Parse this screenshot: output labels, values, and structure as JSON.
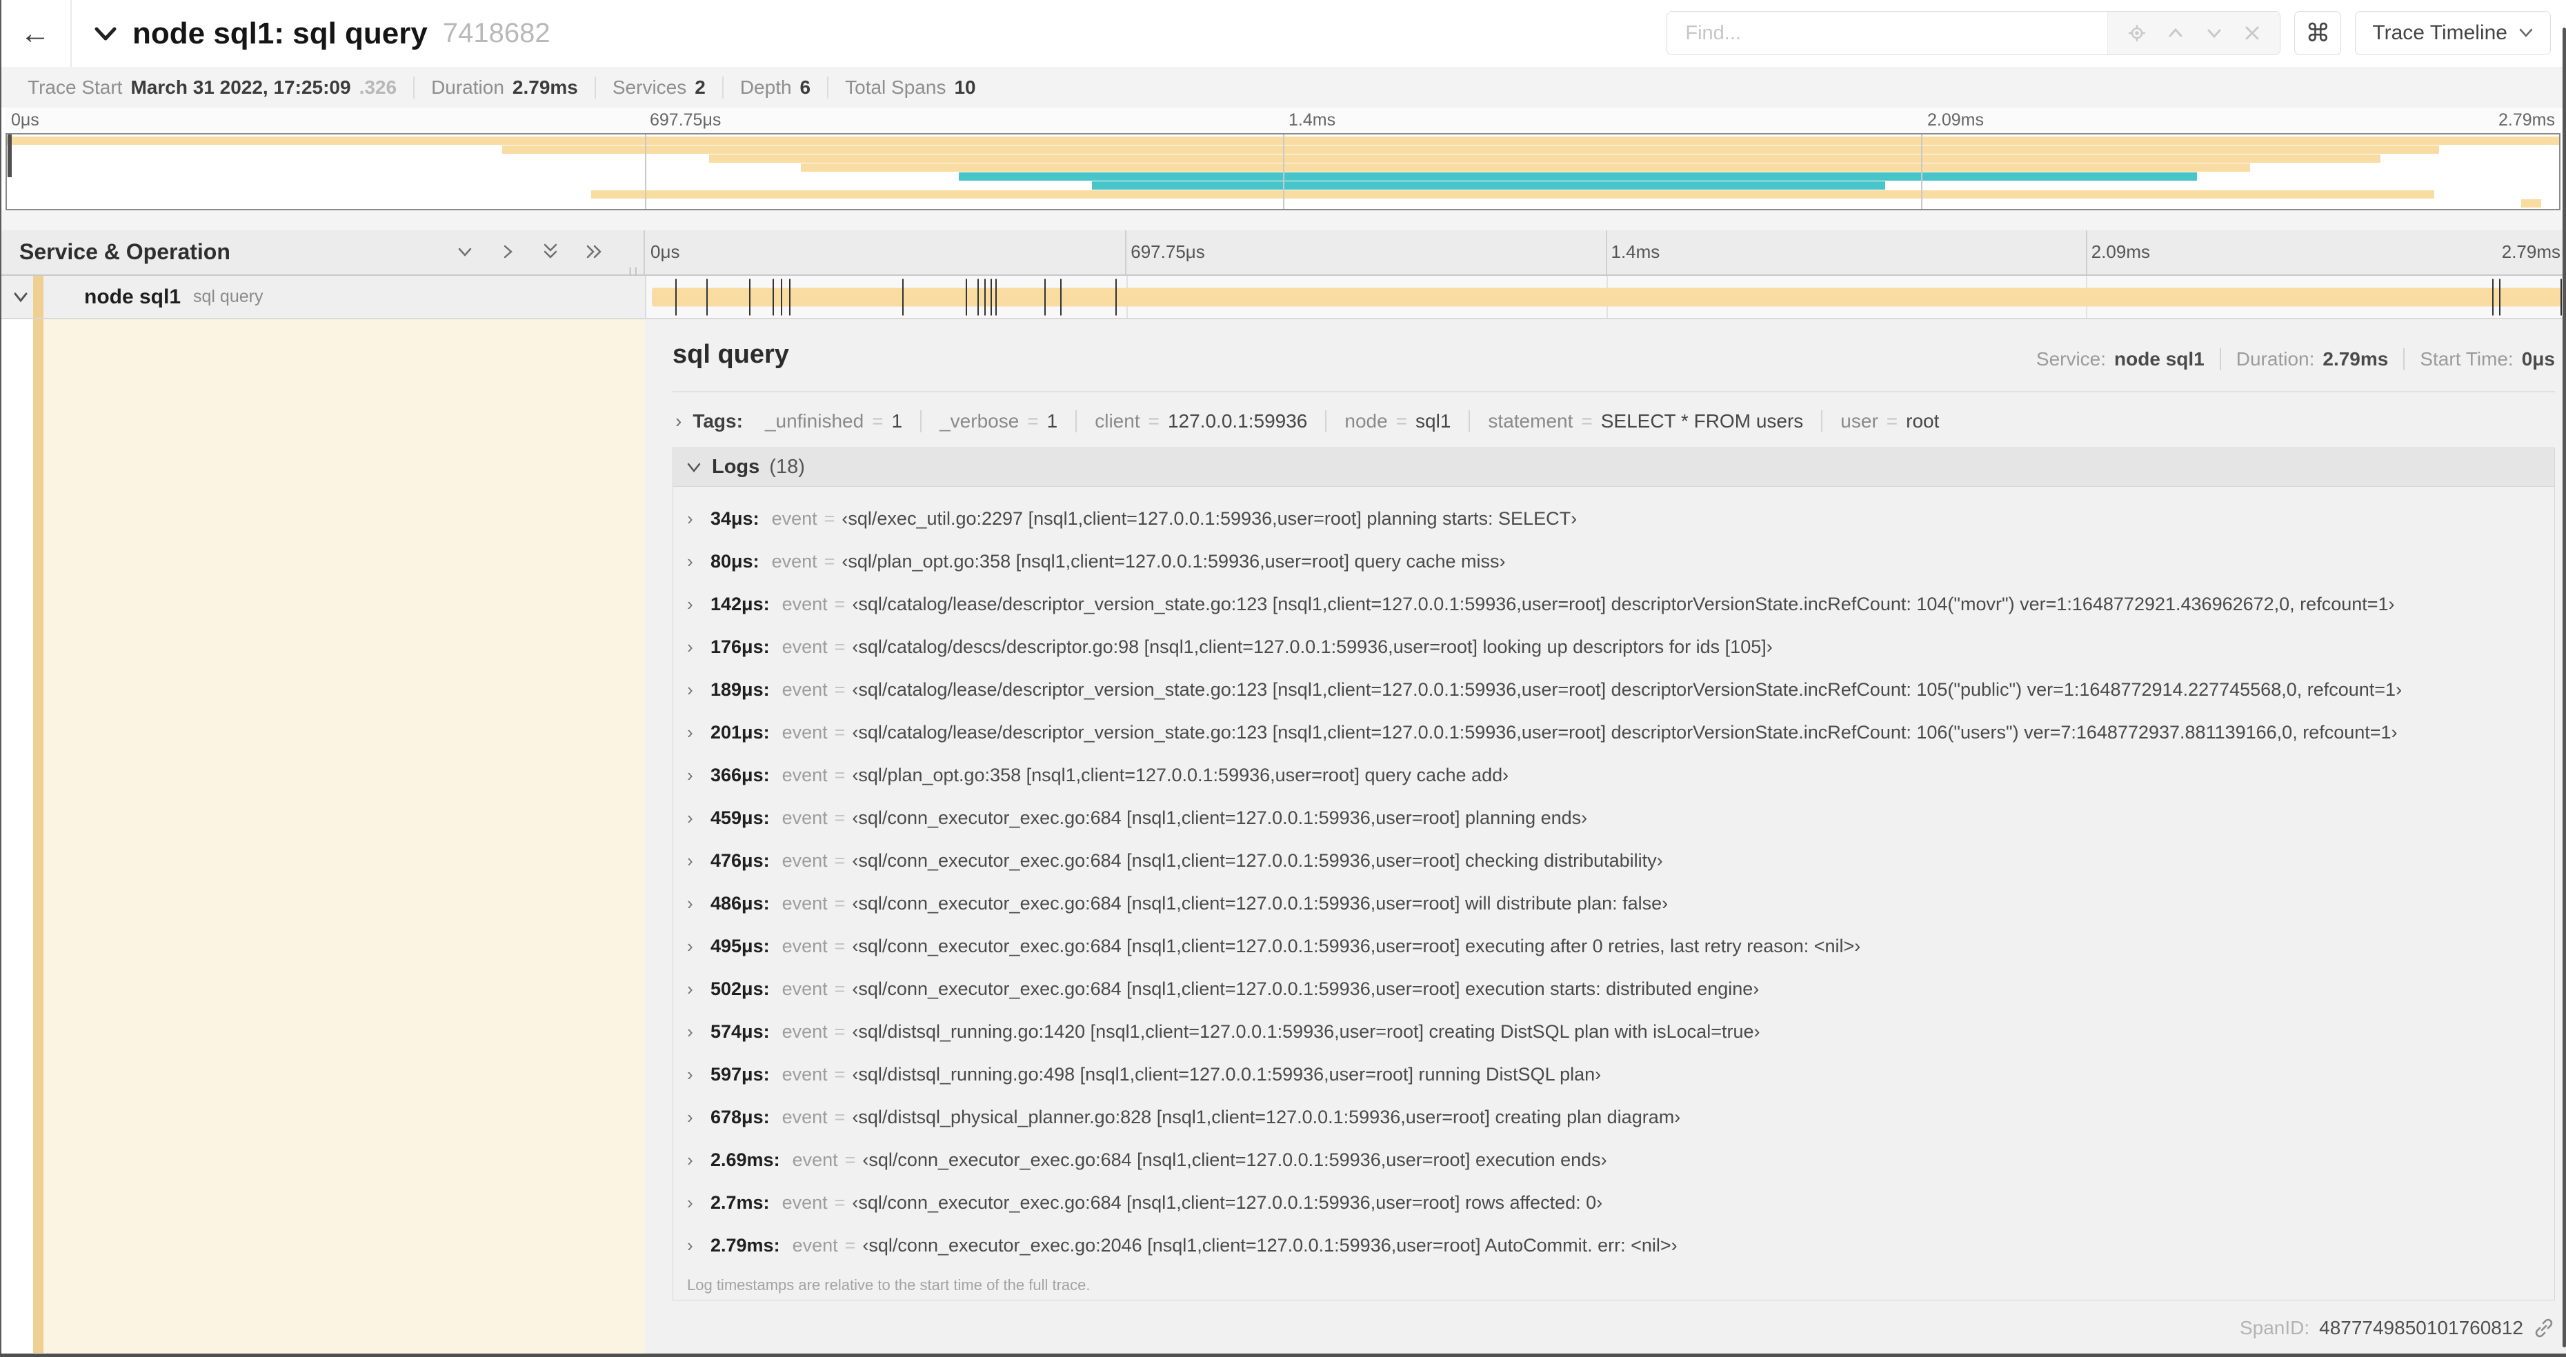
{
  "trace_total_us": 2790,
  "icons": {
    "back_arrow": "←",
    "chevron_right": "›",
    "equals_sign": "=",
    "column_grip": "||"
  },
  "header": {
    "title": "node sql1: sql query",
    "trace_id": "7418682",
    "find_placeholder": "Find...",
    "shortcut_symbol": "⌘",
    "view_selector": "Trace Timeline"
  },
  "summary": {
    "items": [
      {
        "label": "Trace Start",
        "value": "March 31 2022, 17:25:09",
        "suffix": ".326"
      },
      {
        "label": "Duration",
        "value": "2.79ms"
      },
      {
        "label": "Services",
        "value": "2"
      },
      {
        "label": "Depth",
        "value": "6"
      },
      {
        "label": "Total Spans",
        "value": "10"
      }
    ]
  },
  "ticks": [
    "0μs",
    "697.75μs",
    "1.4ms",
    "2.09ms",
    "2.79ms"
  ],
  "minimap": {
    "colors": {
      "tan": "#F8DCA1",
      "teal": "#48C5C9"
    },
    "spans": [
      {
        "start": 0.0,
        "end": 1.0,
        "color": "tan"
      },
      {
        "start": 0.194,
        "end": 0.953,
        "color": "tan"
      },
      {
        "start": 0.275,
        "end": 0.93,
        "color": "tan"
      },
      {
        "start": 0.311,
        "end": 0.879,
        "color": "tan"
      },
      {
        "start": 0.373,
        "end": 0.858,
        "color": "teal"
      },
      {
        "start": 0.425,
        "end": 0.736,
        "color": "teal"
      },
      {
        "start": 0.229,
        "end": 0.951,
        "color": "tan"
      },
      {
        "start": 0.985,
        "end": 0.993,
        "color": "tan"
      }
    ]
  },
  "timeline": {
    "left_header": "Service & Operation",
    "row": {
      "service": "node sql1",
      "operation": "sql query"
    }
  },
  "detail": {
    "title": "sql query",
    "meta": {
      "service_label": "Service:",
      "service_value": "node sql1",
      "duration_label": "Duration:",
      "duration_value": "2.79ms",
      "start_label": "Start Time:",
      "start_value": "0μs"
    },
    "tags_label": "Tags:",
    "tags": [
      {
        "key": "_unfinished",
        "value": "1"
      },
      {
        "key": "_verbose",
        "value": "1"
      },
      {
        "key": "client",
        "value": "127.0.0.1:59936"
      },
      {
        "key": "node",
        "value": "sql1"
      },
      {
        "key": "statement",
        "value": "SELECT * FROM users"
      },
      {
        "key": "user",
        "value": "root"
      }
    ],
    "logs_label": "Logs",
    "logs_count": "(18)",
    "logs_field_label": "event",
    "logs": [
      {
        "time": "34μs:",
        "t_us": 34,
        "value": "‹sql/exec_util.go:2297 [nsql1,client=127.0.0.1:59936,user=root] planning starts: SELECT›"
      },
      {
        "time": "80μs:",
        "t_us": 80,
        "value": "‹sql/plan_opt.go:358 [nsql1,client=127.0.0.1:59936,user=root] query cache miss›"
      },
      {
        "time": "142μs:",
        "t_us": 142,
        "value": "‹sql/catalog/lease/descriptor_version_state.go:123 [nsql1,client=127.0.0.1:59936,user=root] descriptorVersionState.incRefCount: 104(\"movr\") ver=1:1648772921.436962672,0, refcount=1›"
      },
      {
        "time": "176μs:",
        "t_us": 176,
        "value": "‹sql/catalog/descs/descriptor.go:98 [nsql1,client=127.0.0.1:59936,user=root] looking up descriptors for ids [105]›"
      },
      {
        "time": "189μs:",
        "t_us": 189,
        "value": "‹sql/catalog/lease/descriptor_version_state.go:123 [nsql1,client=127.0.0.1:59936,user=root] descriptorVersionState.incRefCount: 105(\"public\") ver=1:1648772914.227745568,0, refcount=1›"
      },
      {
        "time": "201μs:",
        "t_us": 201,
        "value": "‹sql/catalog/lease/descriptor_version_state.go:123 [nsql1,client=127.0.0.1:59936,user=root] descriptorVersionState.incRefCount: 106(\"users\") ver=7:1648772937.881139166,0, refcount=1›"
      },
      {
        "time": "366μs:",
        "t_us": 366,
        "value": "‹sql/plan_opt.go:358 [nsql1,client=127.0.0.1:59936,user=root] query cache add›"
      },
      {
        "time": "459μs:",
        "t_us": 459,
        "value": "‹sql/conn_executor_exec.go:684 [nsql1,client=127.0.0.1:59936,user=root] planning ends›"
      },
      {
        "time": "476μs:",
        "t_us": 476,
        "value": "‹sql/conn_executor_exec.go:684 [nsql1,client=127.0.0.1:59936,user=root] checking distributability›"
      },
      {
        "time": "486μs:",
        "t_us": 486,
        "value": "‹sql/conn_executor_exec.go:684 [nsql1,client=127.0.0.1:59936,user=root] will distribute plan: false›"
      },
      {
        "time": "495μs:",
        "t_us": 495,
        "value": "‹sql/conn_executor_exec.go:684 [nsql1,client=127.0.0.1:59936,user=root] executing after 0 retries, last retry reason: <nil>›"
      },
      {
        "time": "502μs:",
        "t_us": 502,
        "value": "‹sql/conn_executor_exec.go:684 [nsql1,client=127.0.0.1:59936,user=root] execution starts: distributed engine›"
      },
      {
        "time": "574μs:",
        "t_us": 574,
        "value": "‹sql/distsql_running.go:1420 [nsql1,client=127.0.0.1:59936,user=root] creating DistSQL plan with isLocal=true›"
      },
      {
        "time": "597μs:",
        "t_us": 597,
        "value": "‹sql/distsql_running.go:498 [nsql1,client=127.0.0.1:59936,user=root] running DistSQL plan›"
      },
      {
        "time": "678μs:",
        "t_us": 678,
        "value": "‹sql/distsql_physical_planner.go:828 [nsql1,client=127.0.0.1:59936,user=root] creating plan diagram›"
      },
      {
        "time": "2.69ms:",
        "t_us": 2690,
        "value": "‹sql/conn_executor_exec.go:684 [nsql1,client=127.0.0.1:59936,user=root] execution ends›"
      },
      {
        "time": "2.7ms:",
        "t_us": 2700,
        "value": "‹sql/conn_executor_exec.go:684 [nsql1,client=127.0.0.1:59936,user=root] rows affected: 0›"
      },
      {
        "time": "2.79ms:",
        "t_us": 2790,
        "value": "‹sql/conn_executor_exec.go:2046 [nsql1,client=127.0.0.1:59936,user=root] AutoCommit. err: <nil>›"
      }
    ],
    "note": "Log timestamps are relative to the start time of the full trace.",
    "span_id_label": "SpanID:",
    "span_id": "4877749850101760812"
  }
}
